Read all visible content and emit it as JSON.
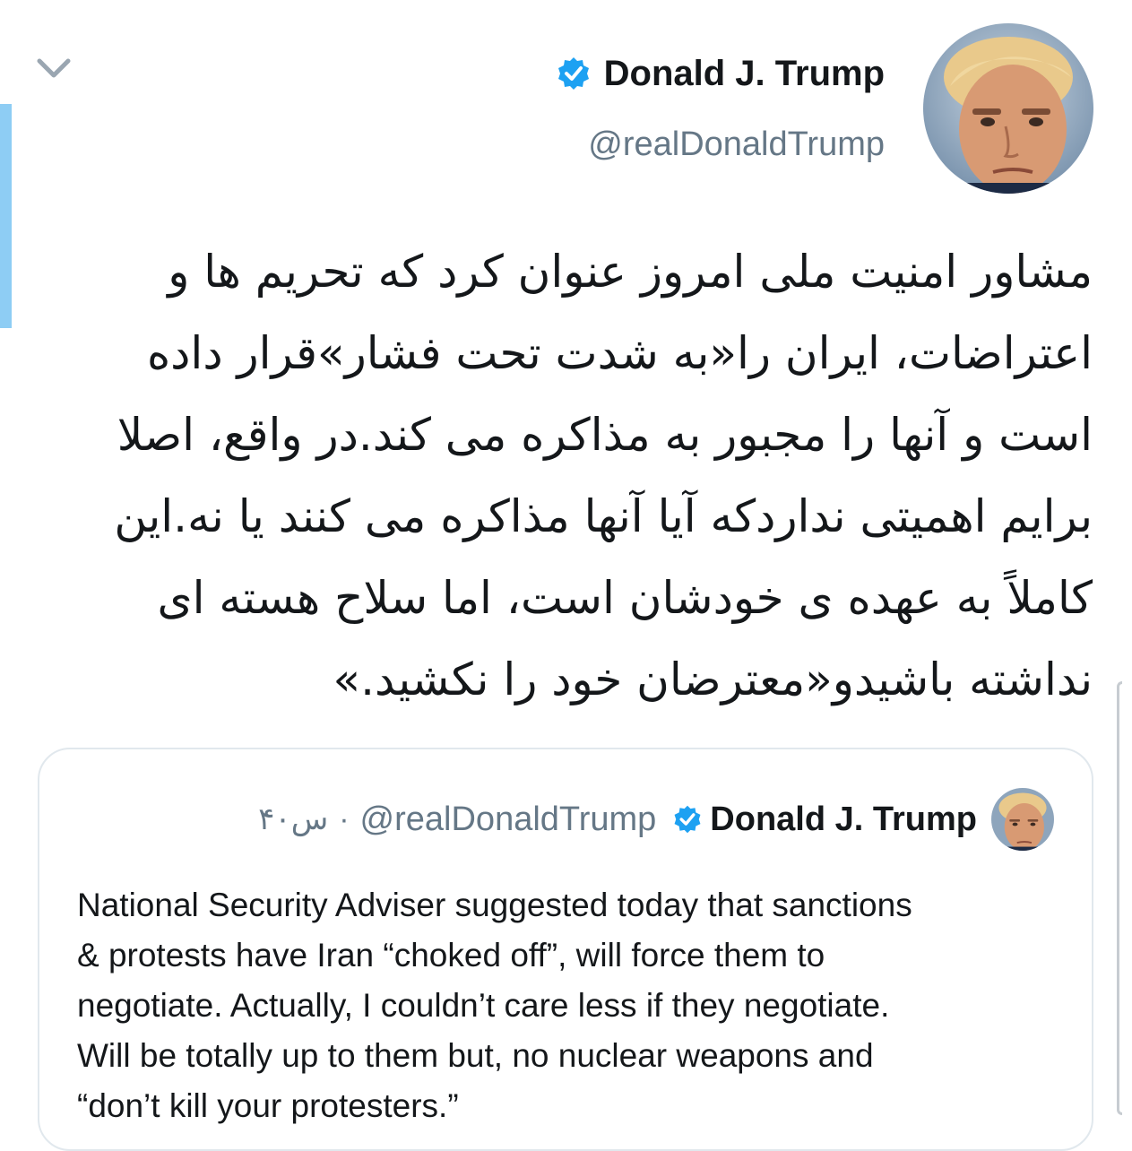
{
  "tweet": {
    "author_name": "Donald J. Trump",
    "author_handle": "@realDonaldTrump",
    "avatar_icon": "avatar-photo",
    "verified_icon": "verified-badge-icon",
    "menu_icon": "chevron-down-icon",
    "text_lines": [
      "مشاور امنیت ملی امروز عنوان کرد که تحریم ها و",
      "اعتراضات، ایران را«به شدت تحت فشار»قرار داده",
      "است و آنها را مجبور به مذاکره می کند.در واقع، اصلا",
      "برایم اهمیتی نداردکه آیا آنها مذاکره می کنند یا نه.این",
      "کاملاً به عهده ی خودشان است، اما سلاح هسته ای",
      "نداشته باشیدو«معترضان خود را نکشید.»"
    ]
  },
  "quoted_tweet": {
    "author_name": "Donald J. Trump",
    "author_handle": "@realDonaldTrump",
    "separator": "·",
    "time": "۴۰س",
    "text_lines": [
      "National Security Adviser suggested today that sanctions",
      "& protests have Iran “choked off”, will force them to",
      "negotiate. Actually, I couldn’t care less if they negotiate.",
      "Will be totally up to them but, no nuclear weapons and",
      "“don’t kill your protesters.”"
    ]
  },
  "colors": {
    "verified_blue": "#1da1f2",
    "handle_gray": "#657786",
    "accent_bar": "#8ecdf4",
    "border": "#e1e8ed"
  }
}
